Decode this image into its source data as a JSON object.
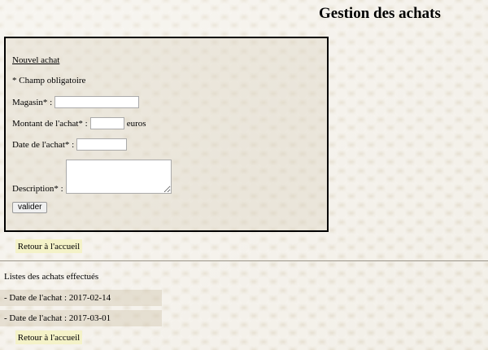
{
  "page": {
    "title": "Gestion des achats"
  },
  "form": {
    "new_purchase_link": "Nouvel achat",
    "required_note": "* Champ obligatoire",
    "store_label": "Magasin* :",
    "store_value": "",
    "amount_label": "Montant de l'achat* :",
    "amount_value": "",
    "amount_unit": "euros",
    "date_label": "Date de l'achat* :",
    "date_value": "",
    "description_label": "Description* :",
    "description_value": "",
    "submit_label": "valider"
  },
  "home_link_label": "Retour à l'accueil",
  "purchases": {
    "heading": "Listes des achats effectués",
    "items": [
      {
        "text": "- Date de l'achat : 2017-02-14"
      },
      {
        "text": "- Date de l'achat : 2017-03-01"
      }
    ]
  }
}
